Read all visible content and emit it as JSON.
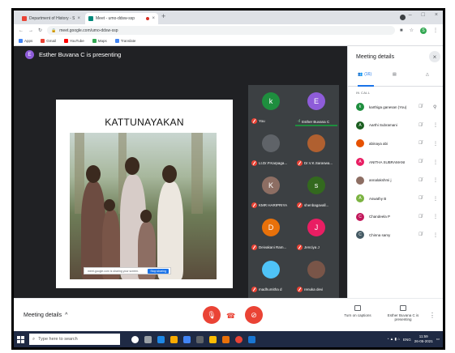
{
  "browser": {
    "tabs": [
      {
        "title": "Department of History - Shree",
        "favicon_color": "#ea4335"
      },
      {
        "title": "Meet - umo-ddsw-ssp",
        "favicon_color": "#00897b"
      }
    ],
    "new_tab": "+",
    "window_controls": [
      "–",
      "□",
      "×"
    ],
    "url": "meet.google.com/umo-ddsw-ssp",
    "bookmarks": [
      {
        "label": "Apps",
        "color": "#4285f4"
      },
      {
        "label": "Gmail",
        "color": "#ea4335"
      },
      {
        "label": "YouTube",
        "color": "#ff0000"
      },
      {
        "label": "Maps",
        "color": "#34a853"
      },
      {
        "label": "Translate",
        "color": "#4285f4"
      }
    ],
    "profile_initial": "S"
  },
  "meet": {
    "presenter_initial": "E",
    "presenting_text": "Esther Buvana C is presenting",
    "slide": {
      "title": "KATTUNAYAKAN",
      "popup_text": "meet.google.com is sharing your screen.",
      "popup_button": "Stop sharing"
    },
    "tiles": [
      {
        "initial": "k",
        "name": "You",
        "color": "#1e8e3e",
        "muted": true
      },
      {
        "initial": "E",
        "name": "Esther Buvana C",
        "color": "#8e5cd9",
        "muted": false,
        "speaking": true
      },
      {
        "initial": "",
        "name": "Lt.Dr.P.Karpaga...",
        "color": "#5f6368",
        "muted": true
      },
      {
        "initial": "",
        "name": "Dr.V.K.Saraswa...",
        "color": "#b06030",
        "muted": true
      },
      {
        "initial": "K",
        "name": "KMR HARIPRIYA",
        "color": "#8d6e63",
        "muted": true
      },
      {
        "initial": "s",
        "name": "shenbagavall...",
        "color": "#33691e",
        "muted": true
      },
      {
        "initial": "D",
        "name": "Deivakani Ram...",
        "color": "#e8710a",
        "muted": true
      },
      {
        "initial": "J",
        "name": "Jenciya J",
        "color": "#e91e63",
        "muted": true
      },
      {
        "initial": "",
        "name": "madhumitha d",
        "color": "#4fc3f7",
        "muted": true
      },
      {
        "initial": "",
        "name": "renuka devi",
        "color": "#795548",
        "muted": true
      }
    ]
  },
  "panel": {
    "title": "Meeting details",
    "close": "×",
    "tabs": [
      {
        "label": "(16)",
        "icon": "people-icon"
      },
      {
        "label": "",
        "icon": "chat-icon"
      },
      {
        "label": "",
        "icon": "activities-icon"
      }
    ],
    "section": "IN CALL",
    "participants": [
      {
        "initial": "k",
        "name": "karthiga ganesan (You)",
        "color": "#1e8e3e"
      },
      {
        "initial": "A",
        "name": "Aarthi Subramani",
        "color": "#1b5e20"
      },
      {
        "initial": "",
        "name": "abinaya abi",
        "color": "#e65100"
      },
      {
        "initial": "A",
        "name": "ANITHA SUBRAMANI",
        "color": "#e91e63"
      },
      {
        "initial": "",
        "name": "annalakshmi j",
        "color": "#8d6e63"
      },
      {
        "initial": "A",
        "name": "Aswathy B",
        "color": "#7cb342"
      },
      {
        "initial": "C",
        "name": "Chandeela P",
        "color": "#c2185b"
      },
      {
        "initial": "C",
        "name": "Chinna samy",
        "color": "#455a64"
      }
    ]
  },
  "bottom": {
    "meeting_details": "Meeting details",
    "caret": "^",
    "captions": "Turn on captions",
    "presenting": "Esther Buvana C is presenting"
  },
  "taskbar": {
    "search_placeholder": "Type here to search",
    "lang": "ENG",
    "time": "11:59",
    "date": "26-05-2021"
  }
}
